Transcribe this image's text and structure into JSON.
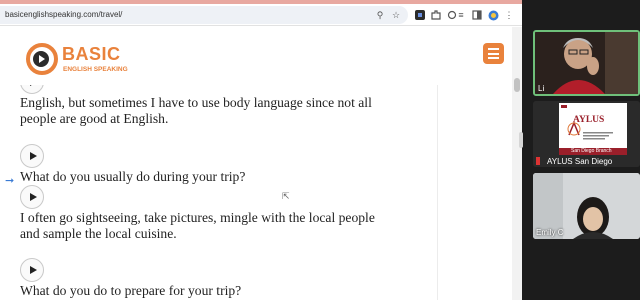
{
  "browser": {
    "url": "basicenglishspeaking.com/travel/"
  },
  "site": {
    "logo_main": "BASIC",
    "logo_sub": "ENGLISH SPEAKING"
  },
  "content": {
    "lines": [
      "English, but sometimes I have to use body language since not all",
      "people are good at English.",
      "What do you usually do during your trip?",
      "I often go sightseeing, take pictures, mingle with the local people",
      "and sample the local cuisine.",
      "What do you do to prepare for your trip?"
    ]
  },
  "participants": [
    {
      "name": "Li"
    },
    {
      "name": "AYLUS San Diego",
      "slide_title": "AYLUS",
      "slide_caption": "San Diego Branch"
    },
    {
      "name": "Emily C"
    }
  ],
  "colors": {
    "brand_orange": "#e9823c",
    "active_speaker_border": "#6fc07a"
  }
}
